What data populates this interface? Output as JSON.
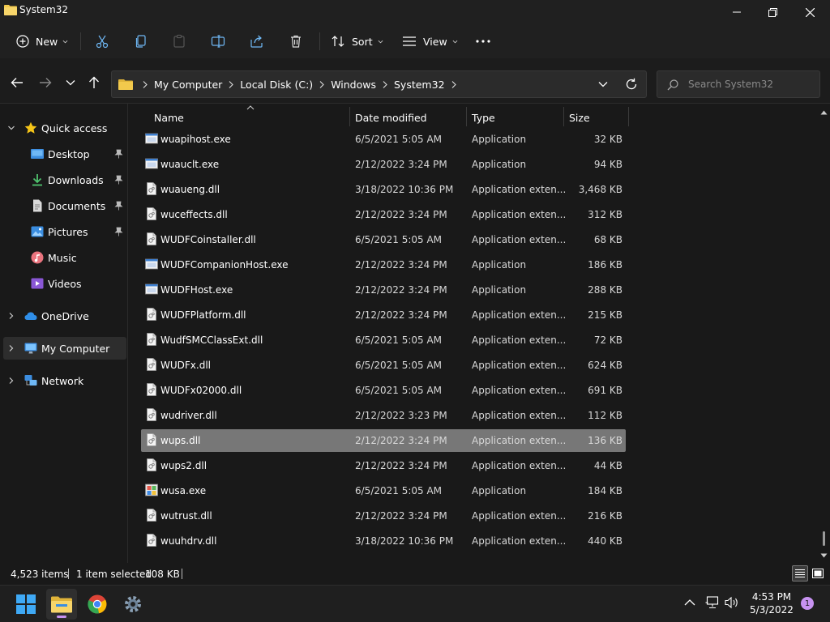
{
  "window": {
    "title": "System32"
  },
  "toolbar": {
    "new_label": "New",
    "sort_label": "Sort",
    "view_label": "View"
  },
  "address": {
    "crumbs": [
      "My Computer",
      "Local Disk (C:)",
      "Windows",
      "System32"
    ]
  },
  "search": {
    "placeholder": "Search System32"
  },
  "sidebar": {
    "quick_access": "Quick access",
    "items": [
      {
        "label": "Desktop",
        "icon": "desktop-icon"
      },
      {
        "label": "Downloads",
        "icon": "downloads-icon"
      },
      {
        "label": "Documents",
        "icon": "documents-icon"
      },
      {
        "label": "Pictures",
        "icon": "pictures-icon"
      },
      {
        "label": "Music",
        "icon": "music-icon"
      },
      {
        "label": "Videos",
        "icon": "videos-icon"
      }
    ],
    "onedrive": "OneDrive",
    "my_computer": "My Computer",
    "network": "Network"
  },
  "columns": {
    "name": "Name",
    "date": "Date modified",
    "type": "Type",
    "size": "Size"
  },
  "files": [
    {
      "name": "wuapihost.exe",
      "date": "6/5/2021 5:05 AM",
      "type": "Application",
      "size": "32 KB",
      "icon": "exe"
    },
    {
      "name": "wuauclt.exe",
      "date": "2/12/2022 3:24 PM",
      "type": "Application",
      "size": "94 KB",
      "icon": "exe"
    },
    {
      "name": "wuaueng.dll",
      "date": "3/18/2022 10:36 PM",
      "type": "Application exten...",
      "size": "3,468 KB",
      "icon": "dll"
    },
    {
      "name": "wuceffects.dll",
      "date": "2/12/2022 3:24 PM",
      "type": "Application exten...",
      "size": "312 KB",
      "icon": "dll"
    },
    {
      "name": "WUDFCoinstaller.dll",
      "date": "6/5/2021 5:05 AM",
      "type": "Application exten...",
      "size": "68 KB",
      "icon": "dll"
    },
    {
      "name": "WUDFCompanionHost.exe",
      "date": "2/12/2022 3:24 PM",
      "type": "Application",
      "size": "186 KB",
      "icon": "exe"
    },
    {
      "name": "WUDFHost.exe",
      "date": "2/12/2022 3:24 PM",
      "type": "Application",
      "size": "288 KB",
      "icon": "exe"
    },
    {
      "name": "WUDFPlatform.dll",
      "date": "2/12/2022 3:24 PM",
      "type": "Application exten...",
      "size": "215 KB",
      "icon": "dll"
    },
    {
      "name": "WudfSMCClassExt.dll",
      "date": "6/5/2021 5:05 AM",
      "type": "Application exten...",
      "size": "72 KB",
      "icon": "dll"
    },
    {
      "name": "WUDFx.dll",
      "date": "6/5/2021 5:05 AM",
      "type": "Application exten...",
      "size": "624 KB",
      "icon": "dll"
    },
    {
      "name": "WUDFx02000.dll",
      "date": "6/5/2021 5:05 AM",
      "type": "Application exten...",
      "size": "691 KB",
      "icon": "dll"
    },
    {
      "name": "wudriver.dll",
      "date": "2/12/2022 3:23 PM",
      "type": "Application exten...",
      "size": "112 KB",
      "icon": "dll"
    },
    {
      "name": "wups.dll",
      "date": "2/12/2022 3:24 PM",
      "type": "Application exten...",
      "size": "136 KB",
      "icon": "dll",
      "selected": true
    },
    {
      "name": "wups2.dll",
      "date": "2/12/2022 3:24 PM",
      "type": "Application exten...",
      "size": "44 KB",
      "icon": "dll"
    },
    {
      "name": "wusa.exe",
      "date": "6/5/2021 5:05 AM",
      "type": "Application",
      "size": "184 KB",
      "icon": "exe-color"
    },
    {
      "name": "wutrust.dll",
      "date": "2/12/2022 3:24 PM",
      "type": "Application exten...",
      "size": "216 KB",
      "icon": "dll"
    },
    {
      "name": "wuuhdrv.dll",
      "date": "3/18/2022 10:36 PM",
      "type": "Application exten...",
      "size": "440 KB",
      "icon": "dll"
    }
  ],
  "status": {
    "item_count": "4,523 items",
    "selection": "1 item selected",
    "selection_size": "108 KB"
  },
  "taskbar": {
    "time": "4:53 PM",
    "date": "5/3/2022",
    "notification_count": "1"
  },
  "colors": {
    "accent": "#c792f0",
    "selected_row": "#777777",
    "folder": "#f2c94c"
  }
}
